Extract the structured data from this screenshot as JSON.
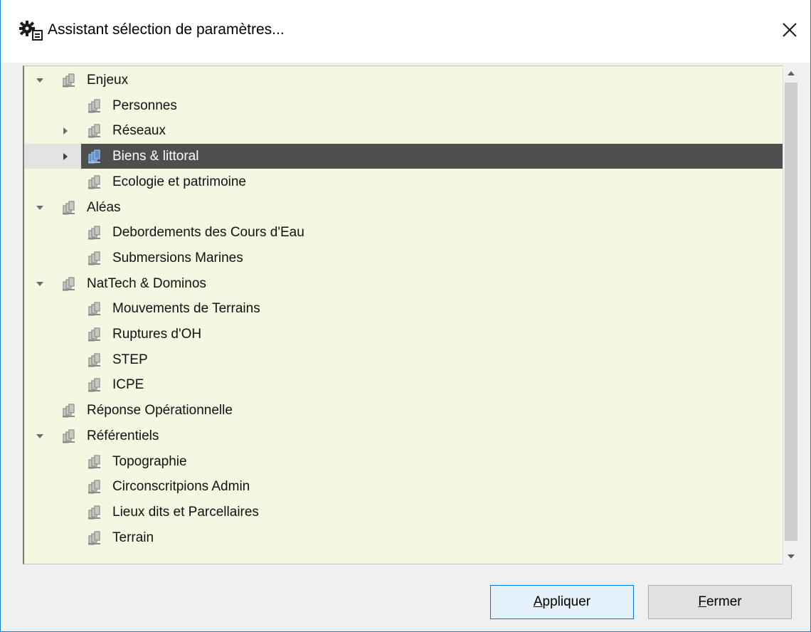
{
  "window": {
    "title": "Assistant sélection de paramètres...",
    "title_icon": "settings-gear-icon",
    "close_icon": "close-icon"
  },
  "tree": {
    "selected": "Biens & littoral",
    "items": [
      {
        "label": "Enjeux",
        "level": 0,
        "expander": "expanded"
      },
      {
        "label": "Personnes",
        "level": 1,
        "expander": "none"
      },
      {
        "label": "Réseaux",
        "level": 1,
        "expander": "collapsed"
      },
      {
        "label": "Biens & littoral",
        "level": 1,
        "expander": "collapsed",
        "selected": true
      },
      {
        "label": "Ecologie et patrimoine",
        "level": 1,
        "expander": "none"
      },
      {
        "label": "Aléas",
        "level": 0,
        "expander": "expanded"
      },
      {
        "label": "Debordements des Cours d'Eau",
        "level": 1,
        "expander": "none"
      },
      {
        "label": "Submersions Marines",
        "level": 1,
        "expander": "none"
      },
      {
        "label": "NatTech & Dominos",
        "level": 0,
        "expander": "expanded"
      },
      {
        "label": "Mouvements de Terrains",
        "level": 1,
        "expander": "none"
      },
      {
        "label": "Ruptures d'OH",
        "level": 1,
        "expander": "none"
      },
      {
        "label": "STEP",
        "level": 1,
        "expander": "none"
      },
      {
        "label": "ICPE",
        "level": 1,
        "expander": "none"
      },
      {
        "label": "Réponse Opérationnelle",
        "level": 0,
        "expander": "none"
      },
      {
        "label": "Référentiels",
        "level": 0,
        "expander": "expanded"
      },
      {
        "label": "Topographie",
        "level": 1,
        "expander": "none"
      },
      {
        "label": "Circonscritpions Admin",
        "level": 1,
        "expander": "none"
      },
      {
        "label": "Lieux dits et Parcellaires",
        "level": 1,
        "expander": "none"
      },
      {
        "label": "Terrain",
        "level": 1,
        "expander": "none"
      }
    ],
    "item_icon": "folder-layers-icon"
  },
  "scrollbar": {
    "up_icon": "scroll-up-arrow-icon",
    "down_icon": "scroll-down-arrow-icon"
  },
  "buttons": {
    "apply_mnemonic": "A",
    "apply_rest": "ppliquer",
    "close_mnemonic": "F",
    "close_rest": "ermer"
  }
}
